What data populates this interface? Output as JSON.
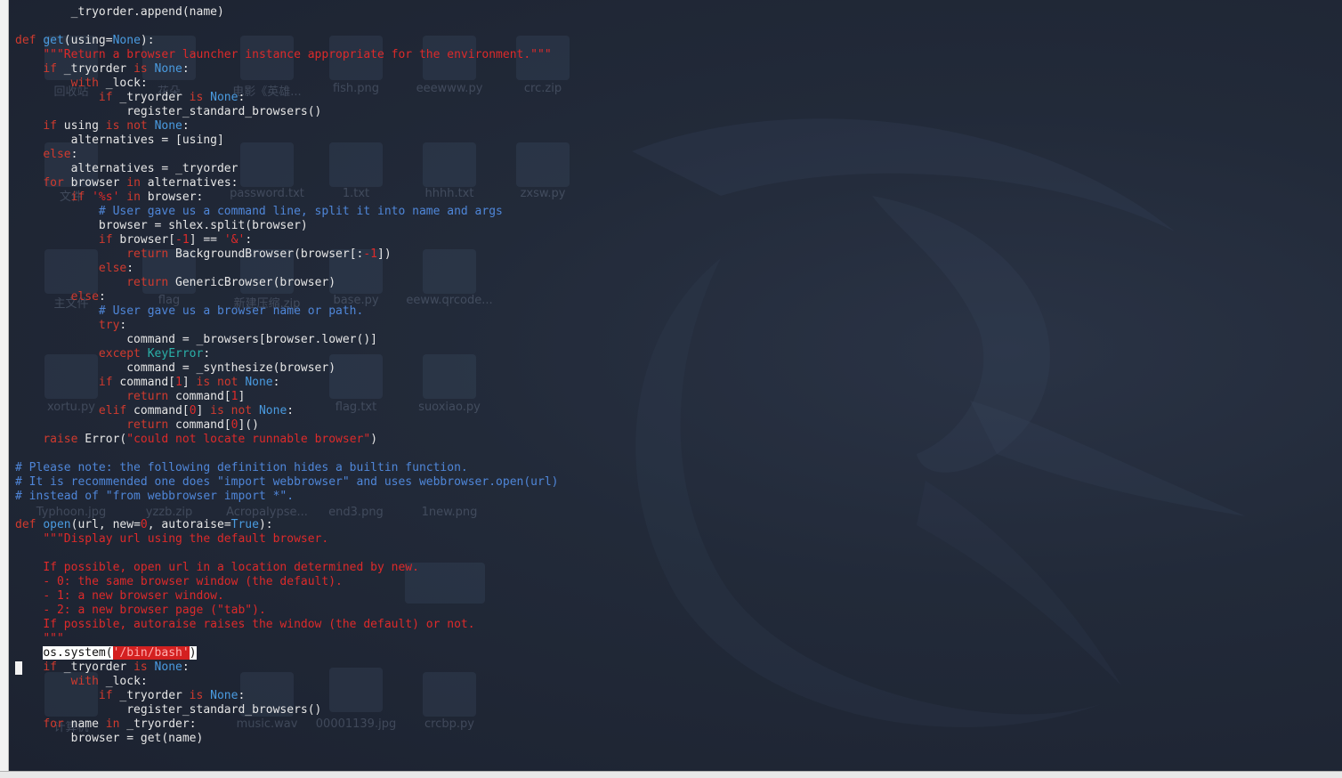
{
  "editor": {
    "lines": [
      [
        {
          "t": "        _tryorder.append(name)",
          "c": "p"
        }
      ],
      [],
      [
        {
          "t": "def ",
          "c": "k"
        },
        {
          "t": "get",
          "c": "b"
        },
        {
          "t": "(using=",
          "c": "p"
        },
        {
          "t": "None",
          "c": "b"
        },
        {
          "t": "):",
          "c": "p"
        }
      ],
      [
        {
          "t": "    ",
          "c": "p"
        },
        {
          "t": "\"\"\"Return a browser launcher instance appropriate for the environment.\"\"\"",
          "c": "s"
        }
      ],
      [
        {
          "t": "    ",
          "c": "p"
        },
        {
          "t": "if",
          "c": "k"
        },
        {
          "t": " _tryorder ",
          "c": "p"
        },
        {
          "t": "is",
          "c": "k"
        },
        {
          "t": " ",
          "c": "p"
        },
        {
          "t": "None",
          "c": "b"
        },
        {
          "t": ":",
          "c": "p"
        }
      ],
      [
        {
          "t": "        ",
          "c": "p"
        },
        {
          "t": "with",
          "c": "k"
        },
        {
          "t": " _lock:",
          "c": "p"
        }
      ],
      [
        {
          "t": "            ",
          "c": "p"
        },
        {
          "t": "if",
          "c": "k"
        },
        {
          "t": " _tryorder ",
          "c": "p"
        },
        {
          "t": "is",
          "c": "k"
        },
        {
          "t": " ",
          "c": "p"
        },
        {
          "t": "None",
          "c": "b"
        },
        {
          "t": ":",
          "c": "p"
        }
      ],
      [
        {
          "t": "                register_standard_browsers()",
          "c": "p"
        }
      ],
      [
        {
          "t": "    ",
          "c": "p"
        },
        {
          "t": "if",
          "c": "k"
        },
        {
          "t": " using ",
          "c": "p"
        },
        {
          "t": "is not",
          "c": "k"
        },
        {
          "t": " ",
          "c": "p"
        },
        {
          "t": "None",
          "c": "b"
        },
        {
          "t": ":",
          "c": "p"
        }
      ],
      [
        {
          "t": "        alternatives = [using]",
          "c": "p"
        }
      ],
      [
        {
          "t": "    ",
          "c": "p"
        },
        {
          "t": "else",
          "c": "k"
        },
        {
          "t": ":",
          "c": "p"
        }
      ],
      [
        {
          "t": "        alternatives = _tryorder",
          "c": "p"
        }
      ],
      [
        {
          "t": "    ",
          "c": "p"
        },
        {
          "t": "for",
          "c": "k"
        },
        {
          "t": " browser ",
          "c": "p"
        },
        {
          "t": "in",
          "c": "k"
        },
        {
          "t": " alternatives:",
          "c": "p"
        }
      ],
      [
        {
          "t": "        ",
          "c": "p"
        },
        {
          "t": "if",
          "c": "k"
        },
        {
          "t": " ",
          "c": "p"
        },
        {
          "t": "'%s'",
          "c": "s"
        },
        {
          "t": " ",
          "c": "p"
        },
        {
          "t": "in",
          "c": "k"
        },
        {
          "t": " browser:",
          "c": "p"
        }
      ],
      [
        {
          "t": "            ",
          "c": "p"
        },
        {
          "t": "# User gave us a command line, split it into name and args",
          "c": "c"
        }
      ],
      [
        {
          "t": "            browser = shlex.split(browser)",
          "c": "p"
        }
      ],
      [
        {
          "t": "            ",
          "c": "p"
        },
        {
          "t": "if",
          "c": "k"
        },
        {
          "t": " browser[",
          "c": "p"
        },
        {
          "t": "-1",
          "c": "n"
        },
        {
          "t": "] == ",
          "c": "p"
        },
        {
          "t": "'&'",
          "c": "s"
        },
        {
          "t": ":",
          "c": "p"
        }
      ],
      [
        {
          "t": "                ",
          "c": "p"
        },
        {
          "t": "return",
          "c": "k"
        },
        {
          "t": " BackgroundBrowser(browser[:",
          "c": "p"
        },
        {
          "t": "-1",
          "c": "n"
        },
        {
          "t": "])",
          "c": "p"
        }
      ],
      [
        {
          "t": "            ",
          "c": "p"
        },
        {
          "t": "else",
          "c": "k"
        },
        {
          "t": ":",
          "c": "p"
        }
      ],
      [
        {
          "t": "                ",
          "c": "p"
        },
        {
          "t": "return",
          "c": "k"
        },
        {
          "t": " GenericBrowser(browser)",
          "c": "p"
        }
      ],
      [
        {
          "t": "        ",
          "c": "p"
        },
        {
          "t": "else",
          "c": "k"
        },
        {
          "t": ":",
          "c": "p"
        }
      ],
      [
        {
          "t": "            ",
          "c": "p"
        },
        {
          "t": "# User gave us a browser name or path.",
          "c": "c"
        }
      ],
      [
        {
          "t": "            ",
          "c": "p"
        },
        {
          "t": "try",
          "c": "k"
        },
        {
          "t": ":",
          "c": "p"
        }
      ],
      [
        {
          "t": "                command = _browsers[browser.lower()]",
          "c": "p"
        }
      ],
      [
        {
          "t": "            ",
          "c": "p"
        },
        {
          "t": "except",
          "c": "k"
        },
        {
          "t": " ",
          "c": "p"
        },
        {
          "t": "KeyError",
          "c": "e"
        },
        {
          "t": ":",
          "c": "p"
        }
      ],
      [
        {
          "t": "                command = _synthesize(browser)",
          "c": "p"
        }
      ],
      [
        {
          "t": "            ",
          "c": "p"
        },
        {
          "t": "if",
          "c": "k"
        },
        {
          "t": " command[",
          "c": "p"
        },
        {
          "t": "1",
          "c": "n"
        },
        {
          "t": "] ",
          "c": "p"
        },
        {
          "t": "is not",
          "c": "k"
        },
        {
          "t": " ",
          "c": "p"
        },
        {
          "t": "None",
          "c": "b"
        },
        {
          "t": ":",
          "c": "p"
        }
      ],
      [
        {
          "t": "                ",
          "c": "p"
        },
        {
          "t": "return",
          "c": "k"
        },
        {
          "t": " command[",
          "c": "p"
        },
        {
          "t": "1",
          "c": "n"
        },
        {
          "t": "]",
          "c": "p"
        }
      ],
      [
        {
          "t": "            ",
          "c": "p"
        },
        {
          "t": "elif",
          "c": "k"
        },
        {
          "t": " command[",
          "c": "p"
        },
        {
          "t": "0",
          "c": "n"
        },
        {
          "t": "] ",
          "c": "p"
        },
        {
          "t": "is not",
          "c": "k"
        },
        {
          "t": " ",
          "c": "p"
        },
        {
          "t": "None",
          "c": "b"
        },
        {
          "t": ":",
          "c": "p"
        }
      ],
      [
        {
          "t": "                ",
          "c": "p"
        },
        {
          "t": "return",
          "c": "k"
        },
        {
          "t": " command[",
          "c": "p"
        },
        {
          "t": "0",
          "c": "n"
        },
        {
          "t": "]()",
          "c": "p"
        }
      ],
      [
        {
          "t": "    ",
          "c": "p"
        },
        {
          "t": "raise",
          "c": "k"
        },
        {
          "t": " Error(",
          "c": "p"
        },
        {
          "t": "\"could not locate runnable browser\"",
          "c": "s"
        },
        {
          "t": ")",
          "c": "p"
        }
      ],
      [],
      [
        {
          "t": "# Please note: the following definition hides a builtin function.",
          "c": "c"
        }
      ],
      [
        {
          "t": "# It is recommended one does \"import webbrowser\" and uses webbrowser.open(url)",
          "c": "c"
        }
      ],
      [
        {
          "t": "# instead of \"from webbrowser import *\".",
          "c": "c"
        }
      ],
      [],
      [
        {
          "t": "def ",
          "c": "k"
        },
        {
          "t": "open",
          "c": "b"
        },
        {
          "t": "(url, new=",
          "c": "p"
        },
        {
          "t": "0",
          "c": "n"
        },
        {
          "t": ", autoraise=",
          "c": "p"
        },
        {
          "t": "True",
          "c": "b"
        },
        {
          "t": "):",
          "c": "p"
        }
      ],
      [
        {
          "t": "    ",
          "c": "p"
        },
        {
          "t": "\"\"\"Display url using the default browser.",
          "c": "s"
        }
      ],
      [],
      [
        {
          "t": "    ",
          "c": "p"
        },
        {
          "t": "If possible, open url in a location determined by new.",
          "c": "s"
        }
      ],
      [
        {
          "t": "    ",
          "c": "p"
        },
        {
          "t": "- 0: the same browser window (the default).",
          "c": "s"
        }
      ],
      [
        {
          "t": "    ",
          "c": "p"
        },
        {
          "t": "- 1: a new browser window.",
          "c": "s"
        }
      ],
      [
        {
          "t": "    ",
          "c": "p"
        },
        {
          "t": "- 2: a new browser page (\"tab\").",
          "c": "s"
        }
      ],
      [
        {
          "t": "    ",
          "c": "p"
        },
        {
          "t": "If possible, autoraise raises the window (the default) or not.",
          "c": "s"
        }
      ],
      [
        {
          "t": "    ",
          "c": "p"
        },
        {
          "t": "\"\"\"",
          "c": "s"
        }
      ],
      [
        {
          "t": "    ",
          "c": "p"
        },
        {
          "t": "os.system(",
          "c": "hl"
        },
        {
          "t": "'/bin/bash'",
          "c": "hs"
        },
        {
          "t": ")",
          "c": "hl"
        }
      ],
      [
        {
          "t": "    ",
          "c": "p"
        },
        {
          "t": "if",
          "c": "k"
        },
        {
          "t": " _tryorder ",
          "c": "p"
        },
        {
          "t": "is",
          "c": "k"
        },
        {
          "t": " ",
          "c": "p"
        },
        {
          "t": "None",
          "c": "b"
        },
        {
          "t": ":",
          "c": "p"
        }
      ],
      [
        {
          "t": "        ",
          "c": "p"
        },
        {
          "t": "with",
          "c": "k"
        },
        {
          "t": " _lock:",
          "c": "p"
        }
      ],
      [
        {
          "t": "            ",
          "c": "p"
        },
        {
          "t": "if",
          "c": "k"
        },
        {
          "t": " _tryorder ",
          "c": "p"
        },
        {
          "t": "is",
          "c": "k"
        },
        {
          "t": " ",
          "c": "p"
        },
        {
          "t": "None",
          "c": "b"
        },
        {
          "t": ":",
          "c": "p"
        }
      ],
      [
        {
          "t": "                register_standard_browsers()",
          "c": "p"
        }
      ],
      [
        {
          "t": "    ",
          "c": "p"
        },
        {
          "t": "for",
          "c": "k"
        },
        {
          "t": " name ",
          "c": "p"
        },
        {
          "t": "in",
          "c": "k"
        },
        {
          "t": " _tryorder:",
          "c": "p"
        }
      ],
      [
        {
          "t": "        browser = get(name)",
          "c": "p"
        }
      ]
    ]
  },
  "desktop": {
    "icon_labels": [
      "回收站",
      "花朵",
      "电影《英雄...",
      "fish.png",
      "eeewww.py",
      "crc.zip",
      "文件",
      "password.txt",
      "1.txt",
      "hhhh.txt",
      "zxsw.py",
      "主文件",
      "flag",
      "新建压缩.zip",
      "base.py",
      "eeww.qrcode...",
      "xortu.py",
      "flag.txt",
      "suoxiao.py",
      "Typhoon.jpg",
      "yzzb.zip",
      "Acropalypse...",
      "end3.png",
      "1new.png",
      "计算机",
      "music.wav",
      "00001139.jpg",
      "crcbp.py"
    ]
  }
}
